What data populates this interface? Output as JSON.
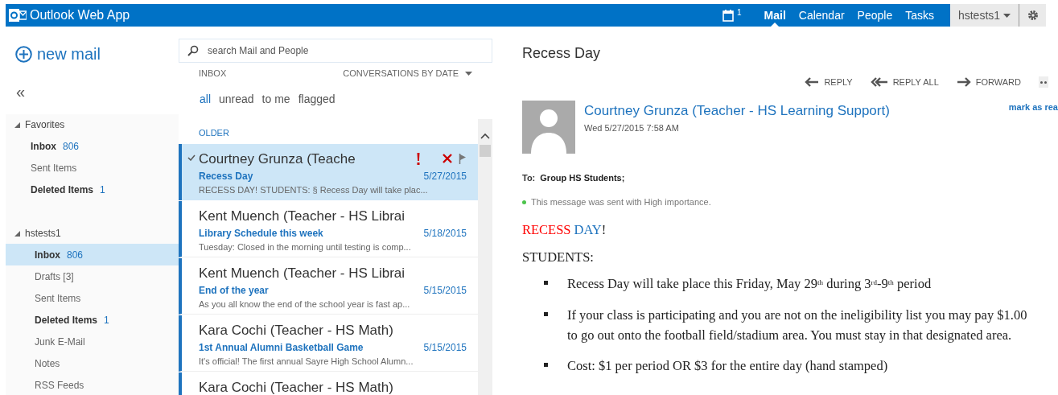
{
  "app_title": "Outlook Web App",
  "top_nav": {
    "calendar_badge": "1",
    "items": [
      {
        "label": "Mail",
        "selected": true
      },
      {
        "label": "Calendar",
        "selected": false
      },
      {
        "label": "People",
        "selected": false
      },
      {
        "label": "Tasks",
        "selected": false
      }
    ],
    "user": "hstests1"
  },
  "sidebar": {
    "new_mail": "new mail",
    "collapse": "«",
    "sections": [
      {
        "title": "Favorites",
        "expanded": true,
        "items": [
          {
            "label": "Inbox",
            "count": "806",
            "bold": true,
            "selected": false
          },
          {
            "label": "Sent Items",
            "bold": false,
            "selected": false
          },
          {
            "label": "Deleted Items",
            "count": "1",
            "bold": true,
            "selected": false
          }
        ]
      },
      {
        "title": "hstests1",
        "expanded": true,
        "items": [
          {
            "label": "Inbox",
            "count": "806",
            "bold": true,
            "selected": true
          },
          {
            "label": "Drafts [3]",
            "bold": false,
            "selected": false
          },
          {
            "label": "Sent Items",
            "bold": false,
            "selected": false
          },
          {
            "label": "Deleted Items",
            "count": "1",
            "bold": true,
            "selected": false
          },
          {
            "label": "Junk E-Mail",
            "bold": false,
            "selected": false
          },
          {
            "label": "Notes",
            "bold": false,
            "selected": false
          },
          {
            "label": "RSS Feeds",
            "bold": false,
            "selected": false
          }
        ]
      }
    ]
  },
  "message_list": {
    "search_placeholder": "search Mail and People",
    "folder": "INBOX",
    "sort": "CONVERSATIONS BY DATE",
    "filters": [
      {
        "label": "all",
        "selected": true
      },
      {
        "label": "unread",
        "selected": false
      },
      {
        "label": "to me",
        "selected": false
      },
      {
        "label": "flagged",
        "selected": false
      }
    ],
    "group": "OLDER",
    "messages": [
      {
        "sender": "Courtney Grunza (Teache",
        "subject": "Recess Day",
        "date": "5/27/2015",
        "preview": "RECESS DAY! STUDENTS: § Recess Day will take plac...",
        "selected": true,
        "high_importance": true
      },
      {
        "sender": "Kent Muench (Teacher - HS Librai",
        "subject": "Library Schedule this week",
        "date": "5/18/2015",
        "preview": "Tuesday: Closed in the morning until testing is comp...",
        "selected": false,
        "high_importance": false
      },
      {
        "sender": "Kent Muench (Teacher - HS Librai",
        "subject": "End of the year",
        "date": "5/15/2015",
        "preview": "As you all know the end of the school year is fast ap...",
        "selected": false,
        "high_importance": false
      },
      {
        "sender": "Kara Cochi (Teacher - HS Math)",
        "subject": "1st Annual Alumni Basketball Game",
        "date": "5/15/2015",
        "preview": "It's official! The first annual Sayre High School Alumn...",
        "selected": false,
        "high_importance": false
      },
      {
        "sender": "Kara Cochi (Teacher - HS Math)",
        "selected": false,
        "high_importance": false
      }
    ]
  },
  "reading_pane": {
    "subject": "Recess Day",
    "actions": [
      "REPLY",
      "REPLY ALL",
      "FORWARD"
    ],
    "mark_as_read": "mark as rea",
    "sender": "Courtney Grunza (Teacher - HS Learning Support)",
    "sent": "Wed 5/27/2015 7:58 AM",
    "to_label": "To:",
    "to": "Group HS Students;",
    "importance_note": "This message was sent with High importance.",
    "body": {
      "heading": [
        {
          "text": "RECESS",
          "color": "#ff0000"
        },
        {
          "text": "DAY",
          "color": "#1e73be"
        },
        {
          "text": "!",
          "color": "#222222"
        }
      ],
      "intro": "STUDENTS:",
      "bullets": [
        "Recess Day will take place this Friday, May 29$^{th}$ during 3$^{rd}$-9$^{th}$ period",
        "If your class is participating and you are not on the ineligibility list you may pay $1.00 to go out onto the football field/stadium area. You must stay in that designated area.",
        "Cost: $1 per period OR $3 for the entire day (hand stamped)"
      ]
    }
  }
}
